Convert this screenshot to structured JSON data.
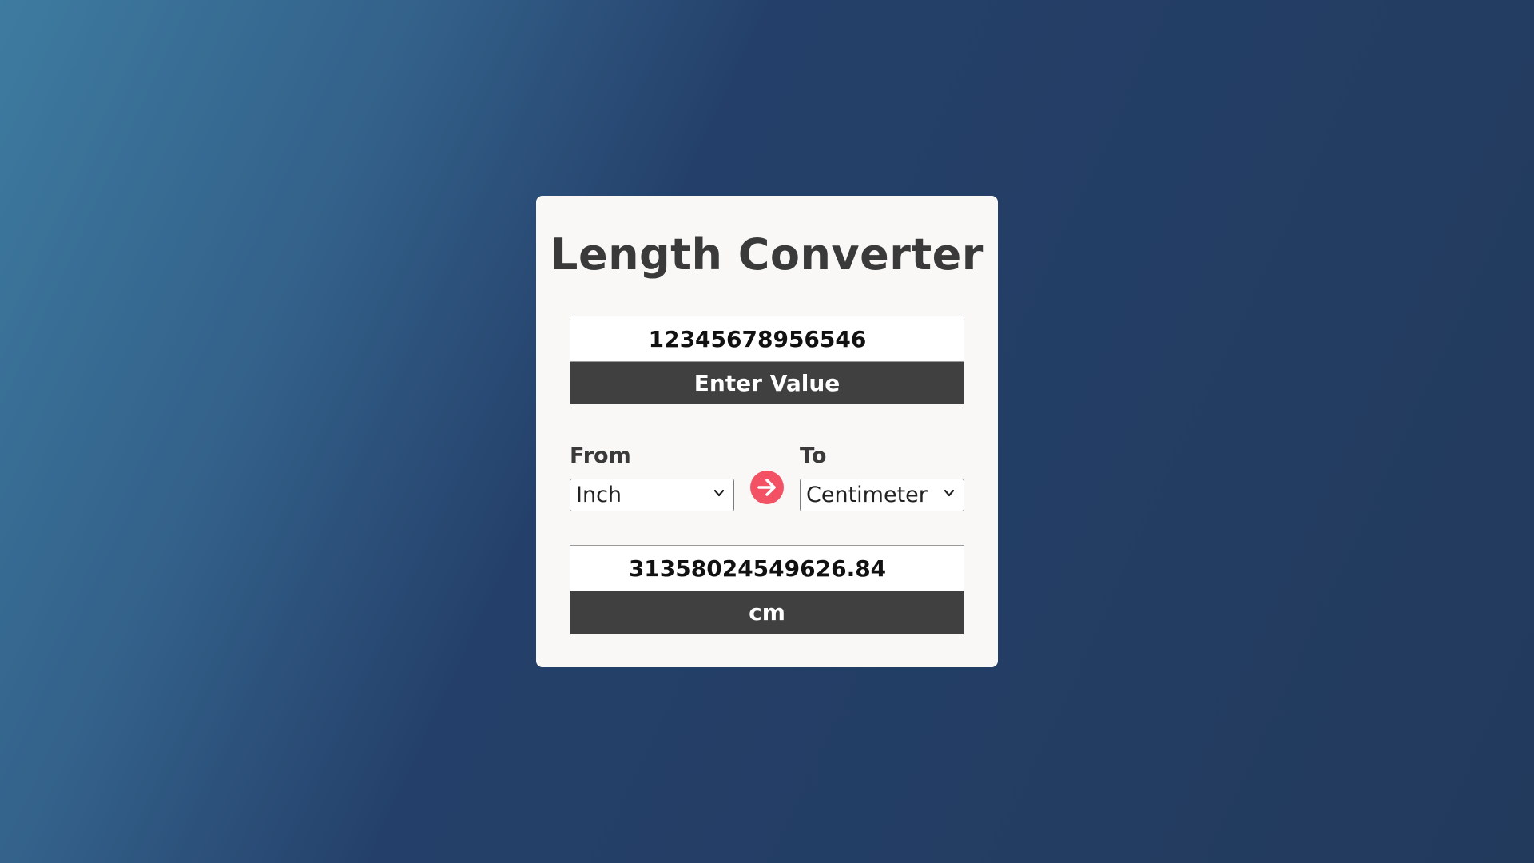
{
  "app": {
    "title": "Length Converter"
  },
  "input": {
    "value": "12345678956546",
    "label": "Enter Value"
  },
  "from": {
    "label": "From",
    "selected": "Inch"
  },
  "to": {
    "label": "To",
    "selected": "Centimeter"
  },
  "swap": {
    "icon": "arrow-right-circle-icon",
    "color": "#f25264"
  },
  "output": {
    "value": "31358024549626.84",
    "unit": "cm"
  },
  "colors": {
    "card": "#f9f8f7",
    "bar": "#404040",
    "accent": "#f25264"
  }
}
